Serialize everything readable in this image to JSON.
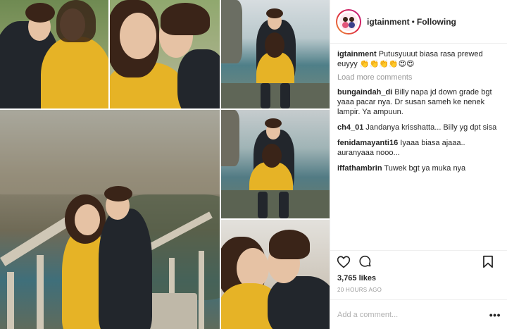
{
  "post": {
    "username": "igtainment",
    "separator": "•",
    "follow_status": "Following",
    "caption_user": "igtainment",
    "caption_text": "Putusyuuut biasa rasa prewed euyyy 👏👏👏👏😍😍",
    "load_more_label": "Load more comments",
    "comments": [
      {
        "user": "bungaindah_di",
        "text": "Billy napa jd down grade bgt yaaa pacar nya. Dr susan sameh ke nenek lampir. Ya ampuun."
      },
      {
        "user": "ch4_01",
        "text": "Jandanya krisshatta... Billy yg dpt sisa"
      },
      {
        "user": "fenidamayanti16",
        "text": "Iyaaa biasa ajaaa.. auranyaaa nooo..."
      },
      {
        "user": "iffathambrin",
        "text": "Tuwek bgt ya muka nya"
      }
    ],
    "likes": "3,765 likes",
    "time": "20 HOURS AGO",
    "add_comment_placeholder": "Add a comment...",
    "more_label": "•••"
  },
  "icons": {
    "like": "heart-icon",
    "comment": "comment-icon",
    "save": "bookmark-icon",
    "more": "more-options-icon"
  },
  "colors": {
    "text": "#262626",
    "muted": "#999999",
    "border": "#efefef",
    "sweater": "#e6b326"
  }
}
